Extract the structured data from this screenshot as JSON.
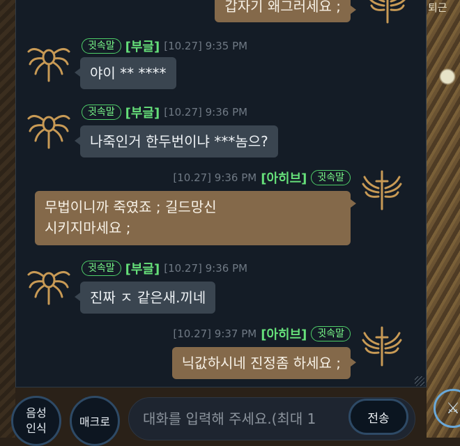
{
  "background": {
    "right_label": "퇴근",
    "right_icon": "crossed-swords-icon"
  },
  "colors": {
    "panel_bg": "#141c26",
    "incoming_bubble": "#3a4550",
    "outgoing_bubble": "#84694a",
    "whisper_green": "#66e07a",
    "timestamp": "#6f7984"
  },
  "messages": [
    {
      "direction": "out",
      "text_lines": [
        "갑자기 왜그러세요 ;"
      ],
      "avatar_icon": "sword-wings-emblem-icon"
    },
    {
      "direction": "in",
      "badge": "귓속말",
      "nickname": "[부글]",
      "time": "[10.27] 9:35 PM",
      "text_lines": [
        "야이 ** ****"
      ],
      "avatar_icon": "spider-emblem-icon"
    },
    {
      "direction": "in",
      "badge": "귓속말",
      "nickname": "[부글]",
      "time": "[10.27] 9:36 PM",
      "text_lines": [
        "나죽인거 한두번이냐 ***놈으?"
      ],
      "avatar_icon": "spider-emblem-icon"
    },
    {
      "direction": "out",
      "badge": "귓속말",
      "nickname": "[아히브]",
      "time": "[10.27] 9:36 PM",
      "text_lines": [
        "무법이니까 죽였죠 ; 길드망신",
        "시키지마세요 ;"
      ],
      "avatar_icon": "sword-wings-emblem-icon"
    },
    {
      "direction": "in",
      "badge": "귓속말",
      "nickname": "[부글]",
      "time": "[10.27] 9:36 PM",
      "text_lines": [
        "진짜 ㅈ 같은새.끼네"
      ],
      "avatar_icon": "spider-emblem-icon"
    },
    {
      "direction": "out",
      "badge": "귓속말",
      "nickname": "[아히브]",
      "time": "[10.27] 9:37 PM",
      "text_lines": [
        "닉값하시네 진정좀 하세요 ;"
      ],
      "avatar_icon": "sword-wings-emblem-icon"
    }
  ],
  "input_bar": {
    "voice_button": [
      "음성",
      "인식"
    ],
    "macro_button": "매크로",
    "placeholder": "대화를 입력해 주세요.(최대 1",
    "send_button": "전송"
  }
}
